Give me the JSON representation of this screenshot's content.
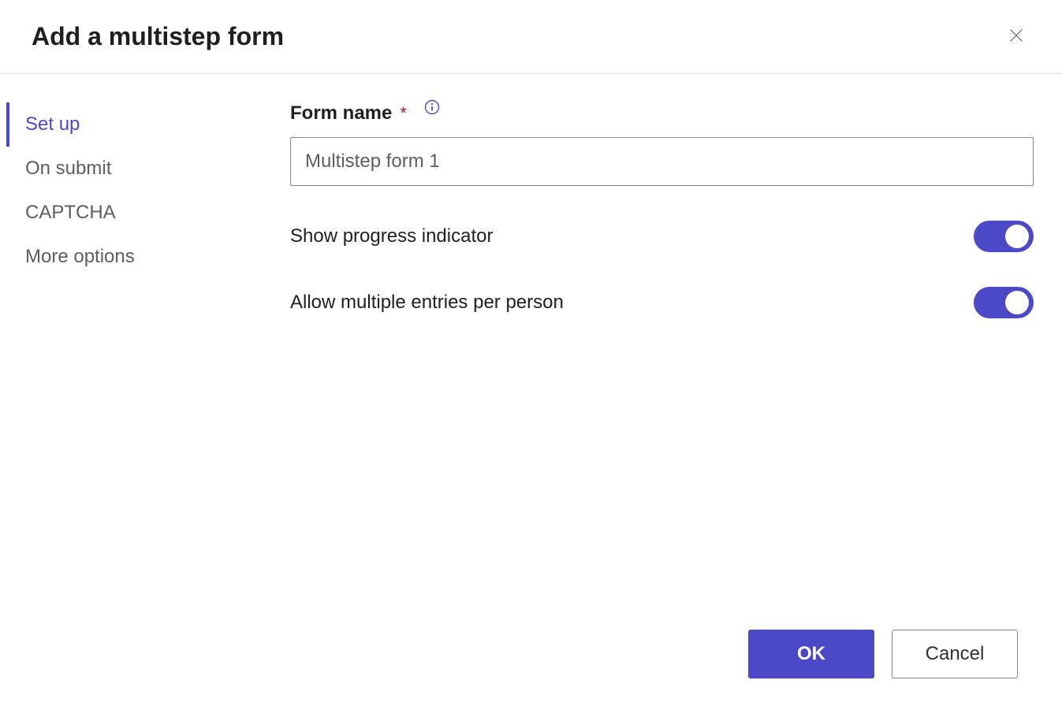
{
  "header": {
    "title": "Add a multistep form"
  },
  "sidebar": {
    "items": [
      {
        "label": "Set up",
        "active": true
      },
      {
        "label": "On submit",
        "active": false
      },
      {
        "label": "CAPTCHA",
        "active": false
      },
      {
        "label": "More options",
        "active": false
      }
    ]
  },
  "form": {
    "name_label": "Form name",
    "name_required_marker": "*",
    "name_value": "Multistep form 1",
    "show_progress_label": "Show progress indicator",
    "show_progress_value": true,
    "allow_multiple_label": "Allow multiple entries per person",
    "allow_multiple_value": true
  },
  "footer": {
    "ok_label": "OK",
    "cancel_label": "Cancel"
  }
}
